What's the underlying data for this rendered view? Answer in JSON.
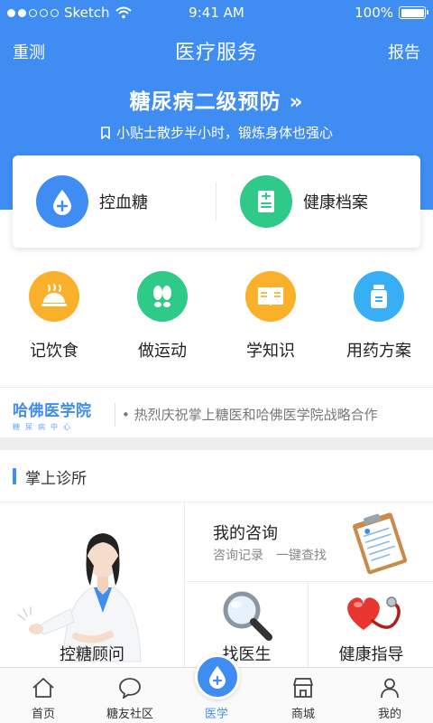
{
  "status_bar": {
    "carrier": "Sketch",
    "time": "9:41 AM",
    "battery": "100%"
  },
  "navbar": {
    "left": "重测",
    "title": "医疗服务",
    "right": "报告"
  },
  "banner": {
    "title": "糖尿病二级预防 »",
    "tip": "小贴士散步半小时，锻炼身体也强心"
  },
  "main_card": {
    "items": [
      {
        "label": "控血糖",
        "icon": "blood-drop-icon",
        "color": "#3f8df2"
      },
      {
        "label": "健康档案",
        "icon": "document-icon",
        "color": "#2fc989"
      }
    ]
  },
  "quick_actions": [
    {
      "label": "记饮食",
      "icon": "food-cloche-icon",
      "color": "#fbb02c"
    },
    {
      "label": "做运动",
      "icon": "footprints-icon",
      "color": "#2fc989"
    },
    {
      "label": "学知识",
      "icon": "book-icon",
      "color": "#fbb02c"
    },
    {
      "label": "用药方案",
      "icon": "medicine-bottle-icon",
      "color": "#38aef5"
    }
  ],
  "news": {
    "logo_title": "哈佛医学院",
    "logo_subtitle": "糖尿病中心",
    "text": "• 热烈庆祝掌上糖医和哈佛医学院战略合作"
  },
  "clinic": {
    "section_title": "掌上诊所",
    "advisor_label": "控糖顾问",
    "consult_title": "我的咨询",
    "consult_sub1": "咨询记录",
    "consult_sub2": "一键查找",
    "doctor_label": "找医生",
    "guide_label": "健康指导"
  },
  "tabbar": {
    "tabs": [
      {
        "label": "首页",
        "icon": "home-icon"
      },
      {
        "label": "糖友社区",
        "icon": "chat-bubble-icon"
      },
      {
        "label": "医学",
        "icon": "blood-drop-icon"
      },
      {
        "label": "商城",
        "icon": "store-icon"
      },
      {
        "label": "我的",
        "icon": "person-icon"
      }
    ],
    "active": "医学"
  },
  "colors": {
    "primary": "#3f8df2",
    "green": "#2fc989",
    "orange": "#fbb02c",
    "cyan": "#38aef5"
  }
}
